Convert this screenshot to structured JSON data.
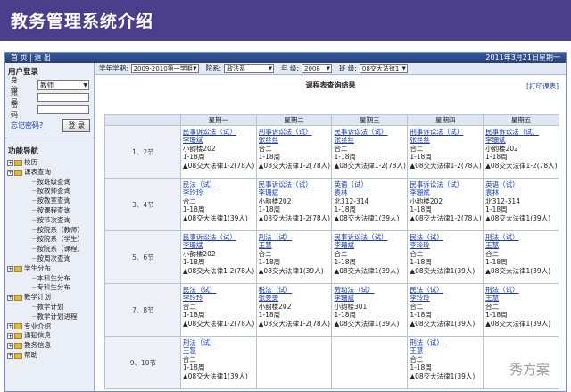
{
  "slide": {
    "title": "教务管理系统介绍"
  },
  "topbar": {
    "nav": "首 页 | 退 出",
    "date": "2011年3月21日星期一"
  },
  "login": {
    "heading": "用户登录",
    "role_label": "身 份",
    "role_value": "教师",
    "account_label": "账 号",
    "password_label": "密 码",
    "forgot": "忘记密码?",
    "login_btn": "登 录"
  },
  "nav": {
    "heading": "功能导航",
    "items": [
      {
        "type": "top",
        "label": "校历"
      },
      {
        "type": "top",
        "label": "课表查询"
      },
      {
        "type": "leaf",
        "label": "按班级查询"
      },
      {
        "type": "leaf",
        "label": "按教师查询"
      },
      {
        "type": "leaf",
        "label": "按教室查询"
      },
      {
        "type": "leaf",
        "label": "按课程查询"
      },
      {
        "type": "leaf",
        "label": "按节次查询"
      },
      {
        "type": "leaf",
        "label": "按院系（教师）"
      },
      {
        "type": "leaf",
        "label": "按院系（学生）"
      },
      {
        "type": "leaf",
        "label": "按院系（课程）"
      },
      {
        "type": "leaf",
        "label": "按周次查询"
      },
      {
        "type": "top",
        "label": "学生分布"
      },
      {
        "type": "leaf",
        "label": "本科生分布"
      },
      {
        "type": "leaf",
        "label": "专科生分布"
      },
      {
        "type": "top",
        "label": "教学计划"
      },
      {
        "type": "leaf",
        "label": "教学计划"
      },
      {
        "type": "leaf",
        "label": "教学计划进程"
      },
      {
        "type": "top",
        "label": "专业介绍"
      },
      {
        "type": "top",
        "label": "通知信息"
      },
      {
        "type": "top",
        "label": "教务信息"
      },
      {
        "type": "top",
        "label": "帮助"
      }
    ]
  },
  "filters": {
    "year_label": "学年学期:",
    "year_value": "2009-2010第一学期",
    "dept_label": "院系:",
    "dept_value": "政法系",
    "grade_label": "年 级:",
    "grade_value": "2008",
    "class_label": "班 级:",
    "class_value": "08交大法律1"
  },
  "result_title": "课程表查询结果",
  "print_link": "[打印课表]",
  "days": [
    "星期一",
    "星期二",
    "星期三",
    "星期四",
    "星期五"
  ],
  "slots": [
    "1、2节",
    "3、4节",
    "5、6节",
    "7、8节",
    "9、10节"
  ],
  "rows": [
    [
      [
        "民事诉讼法（试）",
        "李珊斌",
        "小韵楼202",
        "1-18周",
        "▲08交大法律1-2(78人)"
      ],
      [
        "刑事诉讼法（试）",
        "张丝丝",
        "合二",
        "1-18周",
        "▲08交大法律1-2(78人)"
      ],
      [
        "民事诉讼法（试）",
        "张丝丝",
        "合二",
        "1-18周",
        "▲08交大法律1-2(78人)"
      ],
      [
        "刑事诉讼法（试）",
        "张丝丝",
        "合二",
        "1-18周",
        "▲08交大法律1-2(78人)"
      ],
      [
        "民事诉讼法（试）",
        "李珊斌",
        "小韵楼202",
        "1-18周",
        "▲08交大法律1-2(78人)"
      ]
    ],
    [
      [
        "民法（试）",
        "李玲玲",
        "合二",
        "1-18周",
        "▲08交大法律1(39人)"
      ],
      [
        "民事诉讼法（试）",
        "李珊斌",
        "小韵楼202",
        "1-18周",
        "▲08交大法律1-2(78人)"
      ],
      [
        "英语（试）",
        "袁林",
        "北312-314",
        "1-18周",
        "▲08交大法律1(39人)"
      ],
      [
        "民事诉讼法（试）",
        "李珊斌",
        "小韵楼202",
        "1-18周",
        "▲08交大法律1-2(78人)"
      ],
      [
        "英语（试）",
        "袁林",
        "北312-314",
        "1-18周",
        "▲08交大法律1(39人)"
      ]
    ],
    [
      [
        "民事诉讼法（试）",
        "李珊斌",
        "小韵楼202",
        "1-18周",
        "▲08交大法律1-2(78人)"
      ],
      [
        "刑法（试）",
        "王慧",
        "合二",
        "1-18周",
        "▲08交大法律1(39人)"
      ],
      [
        "民事诉讼法（试）",
        "李珊斌",
        "合二",
        "1-18周",
        "▲08交大法律1(39人)"
      ],
      [
        "民法（试）",
        "李玲玲",
        "合二",
        "1-18周",
        "▲08交大法律1(39人)"
      ],
      [
        "刑法（试）",
        "王慧",
        "合二",
        "1-18周",
        "▲08交大法律1(39人)"
      ]
    ],
    [
      [
        "民法（试）",
        "李玲玲",
        "合二",
        "1-18周",
        "▲08交大法律1-2(78人)"
      ],
      [
        "税法（试）",
        "张雯雯",
        "小韵楼202",
        "1-18周",
        "▲08交大法律1-2(78人)"
      ],
      [
        "劳动法（试）",
        "李珊斌",
        "小韵楼301",
        "1-18周",
        "▲08交大法律1(39人)"
      ],
      [
        "民法（试）",
        "李玲玲",
        "合二",
        "1-18周",
        "▲08交大法律1(39人)"
      ],
      [
        "刑法（试）",
        "王慧",
        "合二",
        "1-18周",
        "▲08交大法律1(39人)"
      ]
    ],
    [
      [
        "刑法（试）",
        "王慧",
        "合二",
        "1-18周",
        "▲08交大法律1(39人)"
      ],
      [],
      [],
      [
        "刑法（试）",
        "王慧",
        "合二",
        "1-18周",
        "▲08交大法律1(39人)"
      ],
      []
    ]
  ],
  "watermark": "秀方案"
}
